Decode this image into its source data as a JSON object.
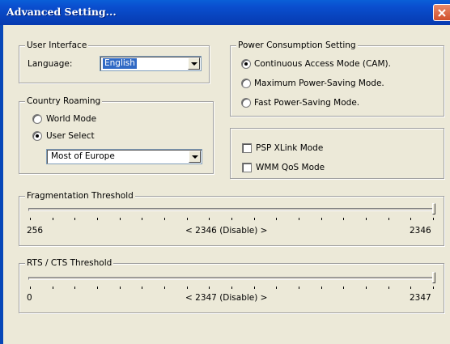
{
  "window": {
    "title": "Advanced Setting..."
  },
  "user_interface": {
    "legend": "User Interface",
    "language_label": "Language:",
    "language_value": "English"
  },
  "country_roaming": {
    "legend": "Country Roaming",
    "options": [
      {
        "label": "World Mode",
        "checked": false
      },
      {
        "label": "User Select",
        "checked": true
      }
    ],
    "region_value": "Most of Europe"
  },
  "power": {
    "legend": "Power Consumption Setting",
    "options": [
      {
        "label": "Continuous Access Mode (CAM).",
        "checked": true
      },
      {
        "label": "Maximum Power-Saving Mode.",
        "checked": false
      },
      {
        "label": "Fast Power-Saving Mode.",
        "checked": false
      }
    ]
  },
  "modes": {
    "psp_xlink": "PSP XLink Mode",
    "wmm_qos": "WMM QoS Mode",
    "psp_checked": false,
    "wmm_checked": false
  },
  "fragmentation": {
    "legend": "Fragmentation Threshold",
    "min": "256",
    "current": "< 2346 (Disable) >",
    "max": "2346",
    "level_fraction": 1.0
  },
  "rts_cts": {
    "legend": "RTS / CTS Threshold",
    "min": "0",
    "current": "< 2347 (Disable) >",
    "max": "2347",
    "level_fraction": 1.0
  },
  "colors": {
    "titlebar": "#0845c0",
    "dialog_bg": "#ece9d8",
    "selection": "#316ac5",
    "close_button": "#d1502c"
  },
  "icons": {
    "close": "close-icon",
    "dropdown": "chevron-down-icon"
  }
}
